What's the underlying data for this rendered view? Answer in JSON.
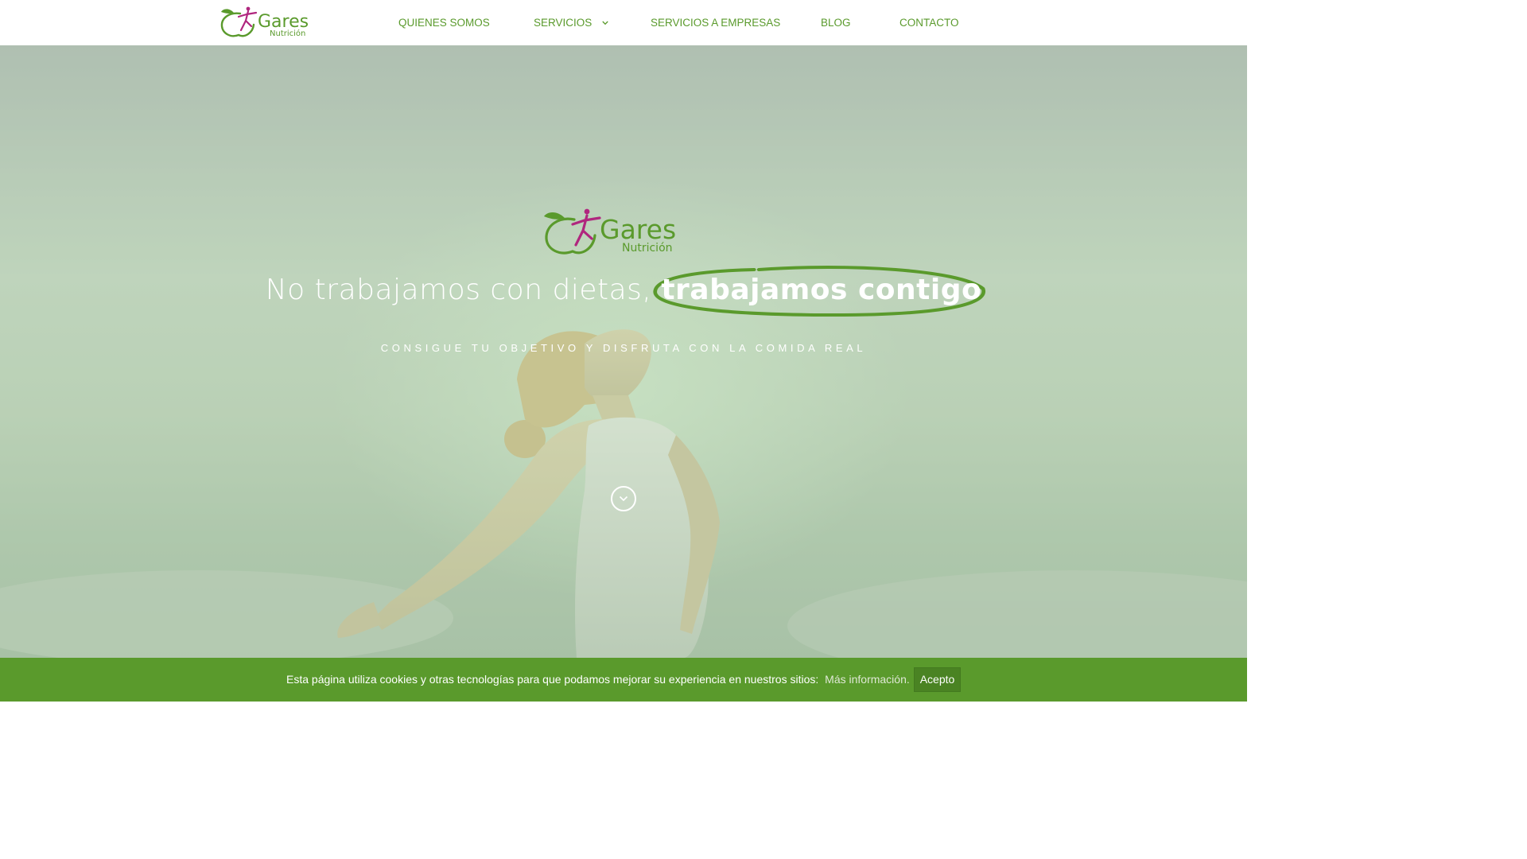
{
  "header": {
    "logo": {
      "brand": "Gares",
      "sub": "Nutrición"
    },
    "nav": [
      {
        "label": "QUIENES SOMOS"
      },
      {
        "label": "SERVICIOS"
      },
      {
        "label": "SERVICIOS A EMPRESAS"
      },
      {
        "label": "BLOG"
      },
      {
        "label": "CONTACTO"
      }
    ]
  },
  "hero": {
    "logo": {
      "brand": "Gares",
      "sub": "Nutrición"
    },
    "headline_lead": "No trabajamos con dietas,",
    "headline_emph": "trabajamos contigo",
    "tagline": "CONSIGUE TU OBJETIVO Y DISFRUTA CON LA COMIDA REAL"
  },
  "cookie": {
    "text": "Esta página utiliza cookies y otras tecnologías para que podamos mejorar su experiencia en nuestros sitios:",
    "link": "Más información.",
    "button": "Acepto"
  },
  "colors": {
    "brand_green": "#5a9a2c",
    "brand_magenta": "#b0267e",
    "white": "#ffffff"
  },
  "icons": {
    "dropdown": "chevron-down-icon",
    "scroll": "chevron-down-circle-icon"
  }
}
